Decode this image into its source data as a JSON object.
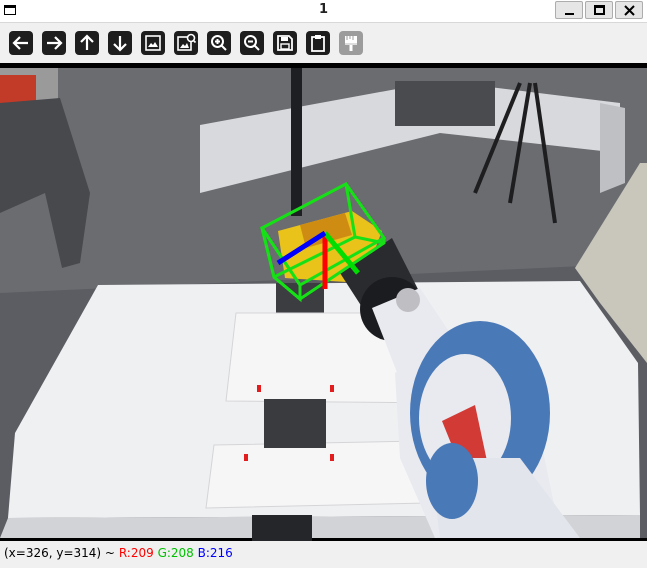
{
  "window": {
    "title": "1"
  },
  "toolbar": {
    "buttons": [
      {
        "icon": "arrow-left-icon",
        "label": "Pan left"
      },
      {
        "icon": "arrow-right-icon",
        "label": "Pan right"
      },
      {
        "icon": "arrow-up-icon",
        "label": "Pan up"
      },
      {
        "icon": "arrow-down-icon",
        "label": "Pan down"
      },
      {
        "icon": "image-icon",
        "label": "Zoom x1"
      },
      {
        "icon": "image-fit-icon",
        "label": "Zoom fit"
      },
      {
        "icon": "zoom-in-icon",
        "label": "Zoom in"
      },
      {
        "icon": "zoom-out-icon",
        "label": "Zoom out"
      },
      {
        "icon": "save-icon",
        "label": "Save current image"
      },
      {
        "icon": "clipboard-icon",
        "label": "Copy to clipboard"
      },
      {
        "icon": "properties-icon",
        "label": "Show properties window",
        "disabled": true
      }
    ]
  },
  "status": {
    "coords": "(x=326, y=314) ~",
    "r": "R:209",
    "g": "G:208",
    "b": "B:216"
  },
  "colors": {
    "bbox": "#16e016",
    "axis_x": "#ff0000",
    "axis_y": "#00dd00",
    "axis_z": "#0000ff",
    "robot_blue": "#4a79b8",
    "robot_white": "#e8eaf0"
  }
}
